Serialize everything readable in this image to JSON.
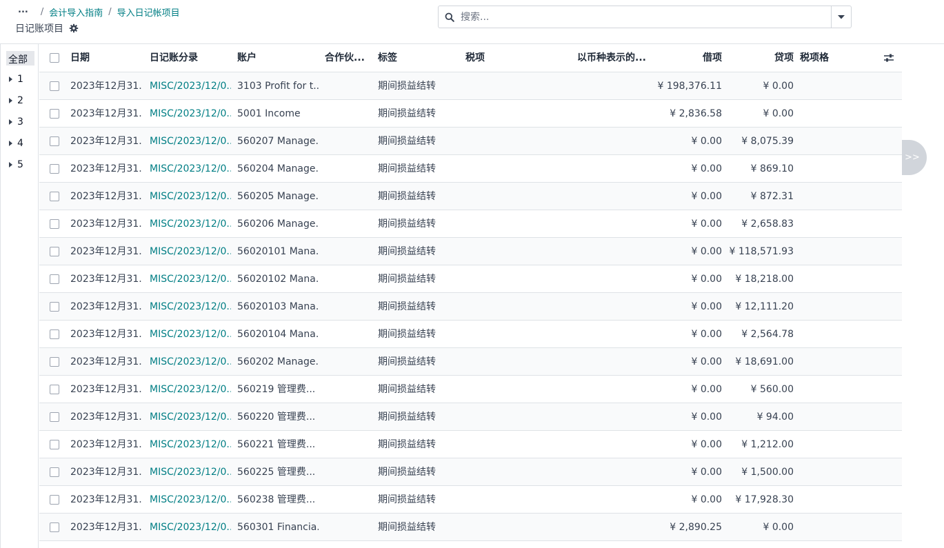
{
  "breadcrumb": {
    "more": "...",
    "sep": "/",
    "items": [
      "会计导入指南",
      "导入日记帐项目"
    ]
  },
  "page_title": "日记账项目",
  "search": {
    "placeholder": "搜索..."
  },
  "sidebar": {
    "all_label": "全部",
    "items": [
      "1",
      "2",
      "3",
      "4",
      "5"
    ]
  },
  "columns": {
    "date": "日期",
    "move": "日记账分录",
    "account": "账户",
    "partner": "合作伙...",
    "label": "标签",
    "tax": "税项",
    "currency": "以币种表示的...",
    "debit": "借项",
    "credit": "贷项",
    "tax_grid": "税项格"
  },
  "rows": [
    {
      "date": "2023年12月31...",
      "move": "MISC/2023/12/0...",
      "account": "3103 Profit for t...",
      "label": "期间损益结转",
      "debit": "¥ 198,376.11",
      "credit": "¥ 0.00"
    },
    {
      "date": "2023年12月31...",
      "move": "MISC/2023/12/0...",
      "account": "5001 Income",
      "label": "期间损益结转",
      "debit": "¥ 2,836.58",
      "credit": "¥ 0.00"
    },
    {
      "date": "2023年12月31...",
      "move": "MISC/2023/12/0...",
      "account": "560207 Manage...",
      "label": "期间损益结转",
      "debit": "¥ 0.00",
      "credit": "¥ 8,075.39"
    },
    {
      "date": "2023年12月31...",
      "move": "MISC/2023/12/0...",
      "account": "560204 Manage...",
      "label": "期间损益结转",
      "debit": "¥ 0.00",
      "credit": "¥ 869.10"
    },
    {
      "date": "2023年12月31...",
      "move": "MISC/2023/12/0...",
      "account": "560205 Manage...",
      "label": "期间损益结转",
      "debit": "¥ 0.00",
      "credit": "¥ 872.31"
    },
    {
      "date": "2023年12月31...",
      "move": "MISC/2023/12/0...",
      "account": "560206 Manage...",
      "label": "期间损益结转",
      "debit": "¥ 0.00",
      "credit": "¥ 2,658.83"
    },
    {
      "date": "2023年12月31...",
      "move": "MISC/2023/12/0...",
      "account": "56020101 Mana...",
      "label": "期间损益结转",
      "debit": "¥ 0.00",
      "credit": "¥ 118,571.93"
    },
    {
      "date": "2023年12月31...",
      "move": "MISC/2023/12/0...",
      "account": "56020102 Mana...",
      "label": "期间损益结转",
      "debit": "¥ 0.00",
      "credit": "¥ 18,218.00"
    },
    {
      "date": "2023年12月31...",
      "move": "MISC/2023/12/0...",
      "account": "56020103 Mana...",
      "label": "期间损益结转",
      "debit": "¥ 0.00",
      "credit": "¥ 12,111.20"
    },
    {
      "date": "2023年12月31...",
      "move": "MISC/2023/12/0...",
      "account": "56020104 Mana...",
      "label": "期间损益结转",
      "debit": "¥ 0.00",
      "credit": "¥ 2,564.78"
    },
    {
      "date": "2023年12月31...",
      "move": "MISC/2023/12/0...",
      "account": "560202 Manage...",
      "label": "期间损益结转",
      "debit": "¥ 0.00",
      "credit": "¥ 18,691.00"
    },
    {
      "date": "2023年12月31...",
      "move": "MISC/2023/12/0...",
      "account": "560219 管理费...",
      "label": "期间损益结转",
      "debit": "¥ 0.00",
      "credit": "¥ 560.00"
    },
    {
      "date": "2023年12月31...",
      "move": "MISC/2023/12/0...",
      "account": "560220 管理费...",
      "label": "期间损益结转",
      "debit": "¥ 0.00",
      "credit": "¥ 94.00"
    },
    {
      "date": "2023年12月31...",
      "move": "MISC/2023/12/0...",
      "account": "560221 管理费...",
      "label": "期间损益结转",
      "debit": "¥ 0.00",
      "credit": "¥ 1,212.00"
    },
    {
      "date": "2023年12月31...",
      "move": "MISC/2023/12/0...",
      "account": "560225 管理费...",
      "label": "期间损益结转",
      "debit": "¥ 0.00",
      "credit": "¥ 1,500.00"
    },
    {
      "date": "2023年12月31...",
      "move": "MISC/2023/12/0...",
      "account": "560238 管理费...",
      "label": "期间损益结转",
      "debit": "¥ 0.00",
      "credit": "¥ 17,928.30"
    },
    {
      "date": "2023年12月31...",
      "move": "MISC/2023/12/0...",
      "account": "560301 Financia...",
      "label": "期间损益结转",
      "debit": "¥ 2,890.25",
      "credit": "¥ 0.00"
    }
  ],
  "expander": {
    "label": ">>"
  },
  "icons": {
    "gear": "gear-icon",
    "search": "search-icon",
    "dropdown": "caret-down-icon",
    "options": "sliders-icon"
  },
  "colors": {
    "link": "#017e84",
    "border": "#dee2e6",
    "row_alt": "#f9fafb"
  }
}
